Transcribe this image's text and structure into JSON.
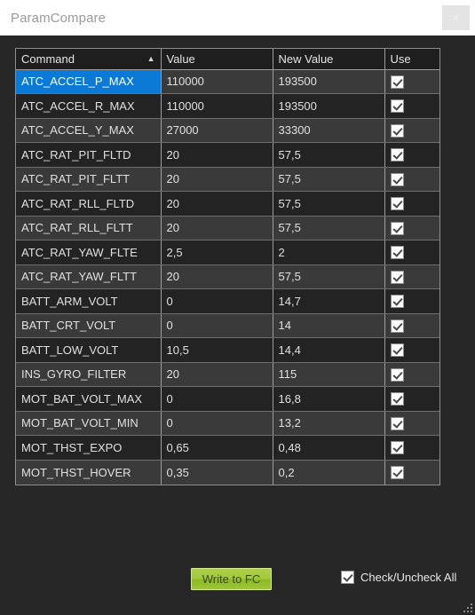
{
  "window": {
    "title": "ParamCompare",
    "close_label": "×"
  },
  "grid": {
    "columns": [
      {
        "key": "command",
        "label": "Command",
        "sort_indicator": "▲"
      },
      {
        "key": "value",
        "label": "Value",
        "sort_indicator": ""
      },
      {
        "key": "new_value",
        "label": "New Value",
        "sort_indicator": ""
      },
      {
        "key": "use",
        "label": "Use",
        "sort_indicator": ""
      }
    ],
    "rows": [
      {
        "command": "ATC_ACCEL_P_MAX",
        "value": "110000",
        "new_value": "193500",
        "use": true,
        "selected": true
      },
      {
        "command": "ATC_ACCEL_R_MAX",
        "value": "110000",
        "new_value": "193500",
        "use": true,
        "selected": false
      },
      {
        "command": "ATC_ACCEL_Y_MAX",
        "value": "27000",
        "new_value": "33300",
        "use": true,
        "selected": false
      },
      {
        "command": "ATC_RAT_PIT_FLTD",
        "value": "20",
        "new_value": "57,5",
        "use": true,
        "selected": false
      },
      {
        "command": "ATC_RAT_PIT_FLTT",
        "value": "20",
        "new_value": "57,5",
        "use": true,
        "selected": false
      },
      {
        "command": "ATC_RAT_RLL_FLTD",
        "value": "20",
        "new_value": "57,5",
        "use": true,
        "selected": false
      },
      {
        "command": "ATC_RAT_RLL_FLTT",
        "value": "20",
        "new_value": "57,5",
        "use": true,
        "selected": false
      },
      {
        "command": "ATC_RAT_YAW_FLTE",
        "value": "2,5",
        "new_value": "2",
        "use": true,
        "selected": false
      },
      {
        "command": "ATC_RAT_YAW_FLTT",
        "value": "20",
        "new_value": "57,5",
        "use": true,
        "selected": false
      },
      {
        "command": "BATT_ARM_VOLT",
        "value": "0",
        "new_value": "14,7",
        "use": true,
        "selected": false
      },
      {
        "command": "BATT_CRT_VOLT",
        "value": "0",
        "new_value": "14",
        "use": true,
        "selected": false
      },
      {
        "command": "BATT_LOW_VOLT",
        "value": "10,5",
        "new_value": "14,4",
        "use": true,
        "selected": false
      },
      {
        "command": "INS_GYRO_FILTER",
        "value": "20",
        "new_value": "115",
        "use": true,
        "selected": false
      },
      {
        "command": "MOT_BAT_VOLT_MAX",
        "value": "0",
        "new_value": "16,8",
        "use": true,
        "selected": false
      },
      {
        "command": "MOT_BAT_VOLT_MIN",
        "value": "0",
        "new_value": "13,2",
        "use": true,
        "selected": false
      },
      {
        "command": "MOT_THST_EXPO",
        "value": "0,65",
        "new_value": "0,48",
        "use": true,
        "selected": false
      },
      {
        "command": "MOT_THST_HOVER",
        "value": "0,35",
        "new_value": "0,2",
        "use": true,
        "selected": false
      }
    ]
  },
  "footer": {
    "write_button_label": "Write to FC",
    "check_all_label": "Check/Uncheck All",
    "check_all_checked": true
  },
  "colors": {
    "accent_selection": "#0b7ad6",
    "button_green": "#a2cb3c",
    "dialog_background": "#272728",
    "titlebar_background": "#ffffff",
    "row_odd": "#3a3a3a",
    "row_even": "#232323"
  }
}
